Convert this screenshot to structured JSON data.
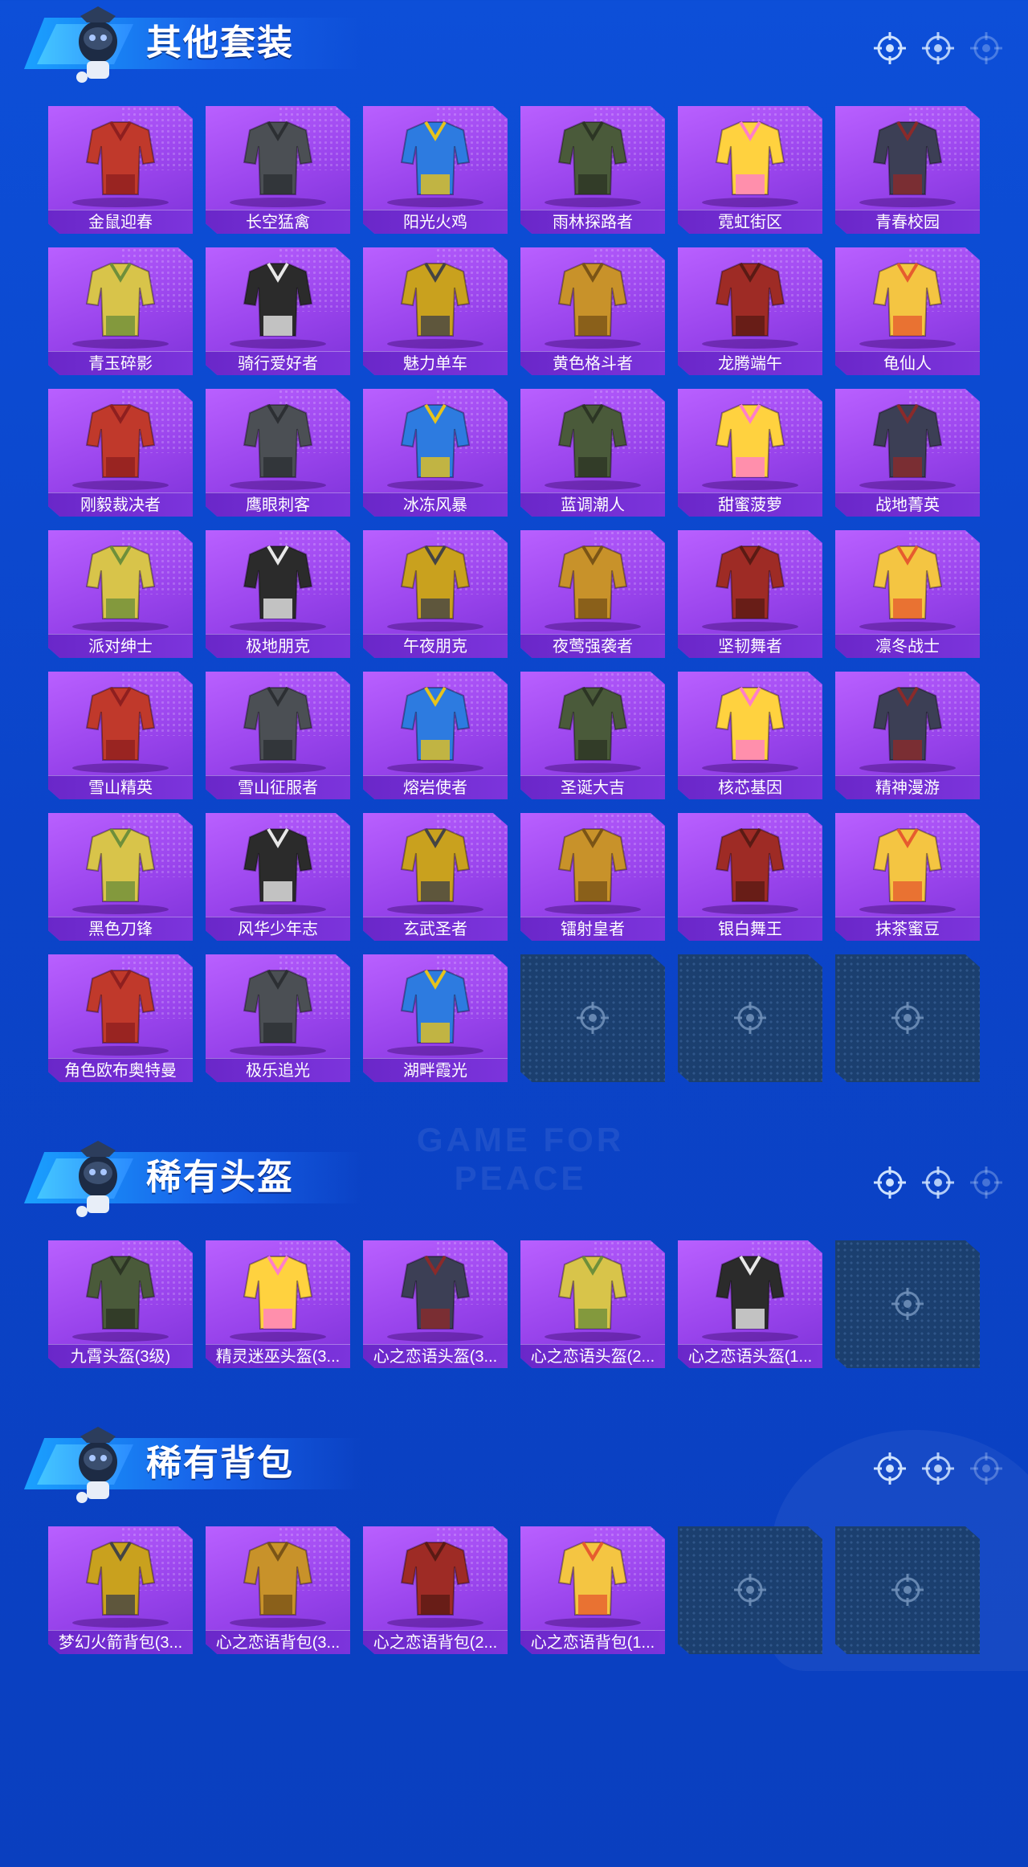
{
  "watermark": "GAME FOR PEACE",
  "sections": [
    {
      "title": "其他套装",
      "items": [
        "金鼠迎春",
        "长空猛禽",
        "阳光火鸡",
        "雨林探路者",
        "霓虹街区",
        "青春校园",
        "青玉碎影",
        "骑行爱好者",
        "魅力单车",
        "黄色格斗者",
        "龙腾端午",
        "龟仙人",
        "刚毅裁决者",
        "鹰眼刺客",
        "冰冻风暴",
        "蓝调潮人",
        "甜蜜菠萝",
        "战地菁英",
        "派对绅士",
        "极地朋克",
        "午夜朋克",
        "夜莺强袭者",
        "坚韧舞者",
        "凛冬战士",
        "雪山精英",
        "雪山征服者",
        "熔岩使者",
        "圣诞大吉",
        "核芯基因",
        "精神漫游",
        "黑色刀锋",
        "风华少年志",
        "玄武圣者",
        "镭射皇者",
        "银白舞王",
        "抹茶蜜豆",
        "角色欧布奥特曼",
        "极乐追光",
        "湖畔霞光"
      ],
      "empty_slots": 3
    },
    {
      "title": "稀有头盔",
      "items": [
        "九霄头盔(3级)",
        "精灵迷巫头盔(3...",
        "心之恋语头盔(3...",
        "心之恋语头盔(2...",
        "心之恋语头盔(1..."
      ],
      "empty_slots": 1
    },
    {
      "title": "稀有背包",
      "items": [
        "梦幻火箭背包(3...",
        "心之恋语背包(3...",
        "心之恋语背包(2...",
        "心之恋语背包(1..."
      ],
      "empty_slots": 2
    }
  ],
  "colors": {
    "background": "#0d4fd8",
    "card_purple": "#a64ff5",
    "label_purple": "#6a27c9",
    "empty_slot": "#1b3f6f",
    "banner_cyan": "#1aa1ff"
  },
  "icons": {
    "section_header": "crosshair-icon",
    "empty_slot": "crosshair-icon",
    "mascot": "mascot-icon"
  }
}
